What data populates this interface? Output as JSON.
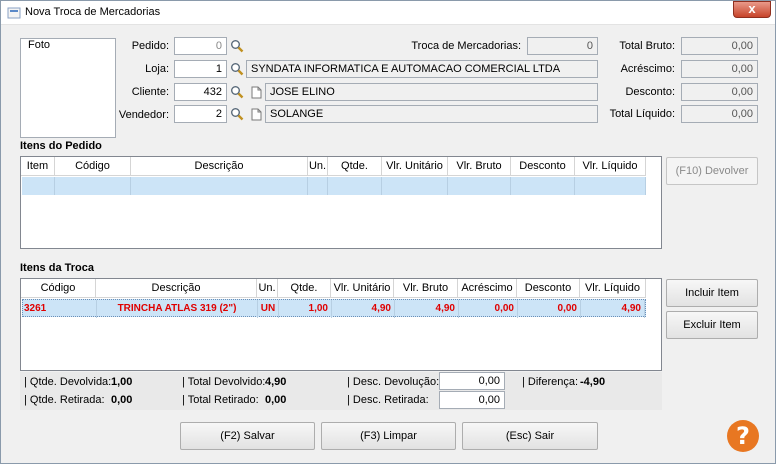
{
  "window": {
    "title": "Nova Troca de Mercadorias",
    "close_glyph": "x"
  },
  "photo": {
    "label": "Foto"
  },
  "form": {
    "pedido": {
      "label": "Pedido:",
      "value": "0"
    },
    "loja": {
      "label": "Loja:",
      "value": "1",
      "name": "SYNDATA INFORMATICA E AUTOMACAO COMERCIAL LTDA"
    },
    "cliente": {
      "label": "Cliente:",
      "value": "432",
      "name": "JOSE ELINO"
    },
    "vendedor": {
      "label": "Vendedor:",
      "value": "2",
      "name": "SOLANGE"
    },
    "troca": {
      "label": "Troca de Mercadorias:",
      "value": "0"
    }
  },
  "totals": {
    "bruto": {
      "label": "Total Bruto:",
      "value": "0,00"
    },
    "acrescimo": {
      "label": "Acréscimo:",
      "value": "0,00"
    },
    "desconto": {
      "label": "Desconto:",
      "value": "0,00"
    },
    "liquido": {
      "label": "Total Líquido:",
      "value": "0,00"
    }
  },
  "pedido_grid": {
    "title": "Itens do Pedido",
    "columns": [
      "Item",
      "Código",
      "Descrição",
      "Un.",
      "Qtde.",
      "Vlr. Unitário",
      "Vlr. Bruto",
      "Desconto",
      "Vlr. Líquido"
    ],
    "devolver_button": "(F10) Devolver"
  },
  "troca_grid": {
    "title": "Itens da Troca",
    "columns": [
      "Código",
      "Descrição",
      "Un.",
      "Qtde.",
      "Vlr. Unitário",
      "Vlr. Bruto",
      "Acréscimo",
      "Desconto",
      "Vlr. Líquido"
    ],
    "rows": [
      {
        "codigo": "3261",
        "descricao": "TRINCHA ATLAS 319 (2\")",
        "un": "UN",
        "qtde": "1,00",
        "unitario": "4,90",
        "bruto": "4,90",
        "acrescimo": "0,00",
        "desconto": "0,00",
        "liquido": "4,90"
      }
    ],
    "incluir_button": "Incluir Item",
    "excluir_button": "Excluir Item"
  },
  "summary": {
    "qtde_devolvida": {
      "label": "| Qtde. Devolvida:",
      "value": "1,00"
    },
    "qtde_retirada": {
      "label": "| Qtde. Retirada:",
      "value": "0,00"
    },
    "total_devolvido": {
      "label": "| Total Devolvido:",
      "value": "4,90"
    },
    "total_retirado": {
      "label": "| Total Retirado:",
      "value": "0,00"
    },
    "desc_devolucao": {
      "label": "| Desc. Devolução:",
      "value": "0,00"
    },
    "desc_retirada": {
      "label": "| Desc. Retirada:",
      "value": "0,00"
    },
    "diferenca": {
      "label": "| Diferença:",
      "value": "-4,90"
    }
  },
  "footer": {
    "salvar": "(F2) Salvar",
    "limpar": "(F3) Limpar",
    "sair": "(Esc) Sair",
    "help_glyph": "?"
  }
}
